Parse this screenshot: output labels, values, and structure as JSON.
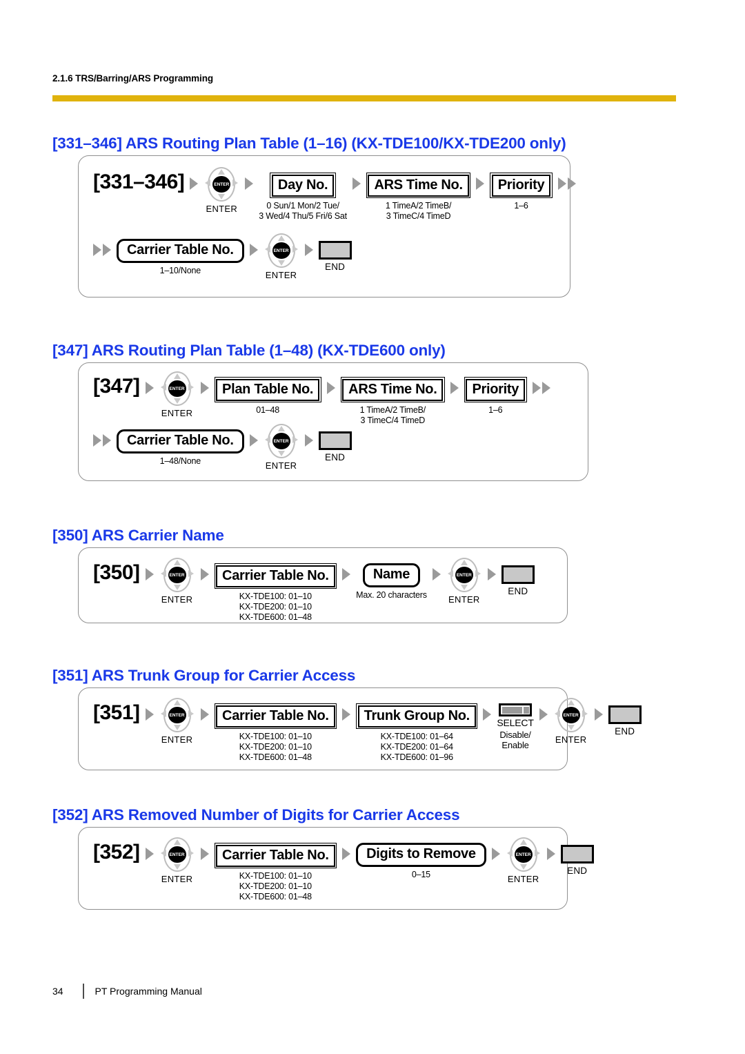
{
  "header": {
    "running_head": "2.1.6 TRS/Barring/ARS Programming",
    "rule_color": "#e0b30d"
  },
  "theme": {
    "heading_color": "#1a39e8",
    "arrow_color": "#9a9a9a",
    "end_key_fill": "#c8c8c8"
  },
  "icons": {
    "enter_core_label": "ENTER",
    "enter_caption": "ENTER",
    "select_caption": "SELECT",
    "end_caption": "END"
  },
  "sections": [
    {
      "heading": "[331–346] ARS Routing Plan Table (1–16) (KX-TDE100/KX-TDE200 only)",
      "code": "[331–346]",
      "rows": [
        {
          "items": [
            {
              "type": "code",
              "label": "[331–346]"
            },
            {
              "type": "arrow"
            },
            {
              "type": "enter",
              "caption": "ENTER"
            },
            {
              "type": "arrow"
            },
            {
              "type": "box-rect",
              "label": "Day No.",
              "sub": "0 Sun/1 Mon/2 Tue/\n3 Wed/4 Thu/5 Fri/6 Sat"
            },
            {
              "type": "arrow"
            },
            {
              "type": "box-rect",
              "label": "ARS Time No.",
              "sub": "1 TimeA/2 TimeB/\n3 TimeC/4 TimeD"
            },
            {
              "type": "arrow"
            },
            {
              "type": "box-rect-thin",
              "label": "Priority",
              "sub": "1–6"
            },
            {
              "type": "arrow2"
            }
          ]
        },
        {
          "items": [
            {
              "type": "arrow2"
            },
            {
              "type": "box-round",
              "label": "Carrier Table No.",
              "sub": "1–10/None"
            },
            {
              "type": "arrow"
            },
            {
              "type": "enter",
              "caption": "ENTER"
            },
            {
              "type": "arrow"
            },
            {
              "type": "end",
              "caption": "END"
            }
          ]
        }
      ]
    },
    {
      "heading": "[347] ARS Routing Plan Table (1–48) (KX-TDE600 only)",
      "code": "[347]",
      "rows": [
        {
          "items": [
            {
              "type": "code",
              "label": "[347]"
            },
            {
              "type": "arrow"
            },
            {
              "type": "enter",
              "caption": "ENTER"
            },
            {
              "type": "arrow"
            },
            {
              "type": "box-rect",
              "label": "Plan Table No.",
              "sub": "01–48"
            },
            {
              "type": "arrow"
            },
            {
              "type": "box-rect",
              "label": "ARS Time No.",
              "sub": "1 TimeA/2 TimeB/\n3 TimeC/4 TimeD"
            },
            {
              "type": "arrow"
            },
            {
              "type": "box-rect-thin",
              "label": "Priority",
              "sub": "1–6"
            },
            {
              "type": "arrow2"
            }
          ]
        },
        {
          "items": [
            {
              "type": "arrow2"
            },
            {
              "type": "box-round",
              "label": "Carrier Table No.",
              "sub": "1–48/None"
            },
            {
              "type": "arrow"
            },
            {
              "type": "enter",
              "caption": "ENTER"
            },
            {
              "type": "arrow"
            },
            {
              "type": "end",
              "caption": "END"
            }
          ]
        }
      ]
    },
    {
      "heading": "[350] ARS Carrier Name",
      "code": "[350]",
      "rows": [
        {
          "items": [
            {
              "type": "code",
              "label": "[350]"
            },
            {
              "type": "arrow"
            },
            {
              "type": "enter",
              "caption": "ENTER"
            },
            {
              "type": "arrow"
            },
            {
              "type": "box-rect",
              "label": "Carrier Table No.",
              "sub": "KX-TDE100: 01–10\nKX-TDE200: 01–10\nKX-TDE600: 01–48"
            },
            {
              "type": "arrow"
            },
            {
              "type": "box-round",
              "label": "Name",
              "sub": "Max. 20 characters"
            },
            {
              "type": "arrow"
            },
            {
              "type": "enter",
              "caption": "ENTER"
            },
            {
              "type": "arrow"
            },
            {
              "type": "end",
              "caption": "END"
            }
          ]
        }
      ]
    },
    {
      "heading": "[351] ARS Trunk Group for Carrier Access",
      "code": "[351]",
      "rows": [
        {
          "items": [
            {
              "type": "code",
              "label": "[351]"
            },
            {
              "type": "arrow"
            },
            {
              "type": "enter",
              "caption": "ENTER"
            },
            {
              "type": "arrow"
            },
            {
              "type": "box-rect",
              "label": "Carrier Table No.",
              "sub": "KX-TDE100: 01–10\nKX-TDE200: 01–10\nKX-TDE600: 01–48"
            },
            {
              "type": "arrow"
            },
            {
              "type": "box-rect",
              "label": "Trunk Group No.",
              "sub": "KX-TDE100: 01–64\nKX-TDE200: 01–64\nKX-TDE600: 01–96"
            },
            {
              "type": "arrow"
            },
            {
              "type": "select",
              "caption": "SELECT",
              "sub": "Disable/\nEnable"
            },
            {
              "type": "arrow"
            },
            {
              "type": "enter",
              "caption": "ENTER"
            },
            {
              "type": "arrow"
            },
            {
              "type": "end",
              "caption": "END"
            }
          ]
        }
      ]
    },
    {
      "heading": "[352] ARS Removed Number of Digits for Carrier Access",
      "code": "[352]",
      "rows": [
        {
          "items": [
            {
              "type": "code",
              "label": "[352]"
            },
            {
              "type": "arrow"
            },
            {
              "type": "enter",
              "caption": "ENTER"
            },
            {
              "type": "arrow"
            },
            {
              "type": "box-rect",
              "label": "Carrier Table No.",
              "sub": "KX-TDE100: 01–10\nKX-TDE200: 01–10\nKX-TDE600: 01–48"
            },
            {
              "type": "arrow"
            },
            {
              "type": "box-round",
              "label": "Digits to Remove",
              "sub": "0–15"
            },
            {
              "type": "arrow"
            },
            {
              "type": "enter",
              "caption": "ENTER"
            },
            {
              "type": "arrow"
            },
            {
              "type": "end",
              "caption": "END"
            }
          ]
        }
      ]
    }
  ],
  "footer": {
    "page_number": "34",
    "manual_title": "PT Programming Manual"
  }
}
